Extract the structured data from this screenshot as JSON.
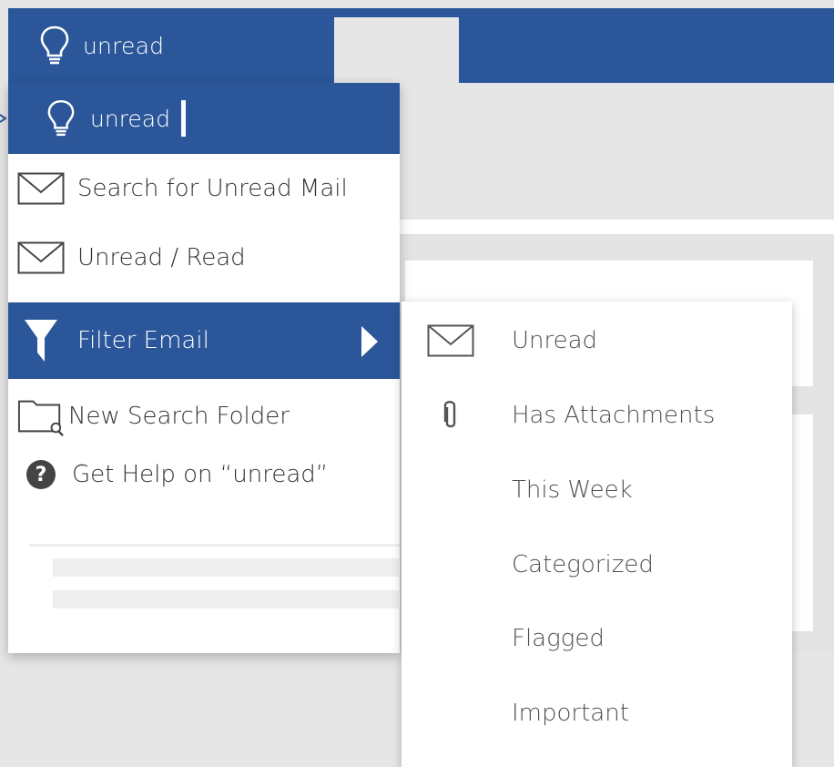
{
  "ribbon": {
    "tell_me_text": "unread",
    "accent_color": "#2b579a",
    "bulb_icon": "lightbulb-icon"
  },
  "dropdown": {
    "search_text": "unread",
    "items": [
      {
        "label": "Search for Unread Mail",
        "icon": "mail-icon"
      },
      {
        "label": "Unread / Read",
        "icon": "mail-icon"
      },
      {
        "label": "Filter Email",
        "icon": "filter-icon",
        "selected": true,
        "submenu_arrow": "chevron-right-icon"
      },
      {
        "label": "New Search Folder",
        "icon": "search-folder-icon"
      },
      {
        "label": "Get Help on “unread”",
        "icon": "help-icon"
      }
    ]
  },
  "submenu": {
    "items": [
      {
        "label": "Unread",
        "icon": "mail-icon"
      },
      {
        "label": "Has Attachments",
        "icon": "paperclip-icon"
      },
      {
        "label": "This Week",
        "icon": ""
      },
      {
        "label": "Categorized",
        "icon": ""
      },
      {
        "label": "Flagged",
        "icon": ""
      },
      {
        "label": "Important",
        "icon": ""
      }
    ]
  }
}
